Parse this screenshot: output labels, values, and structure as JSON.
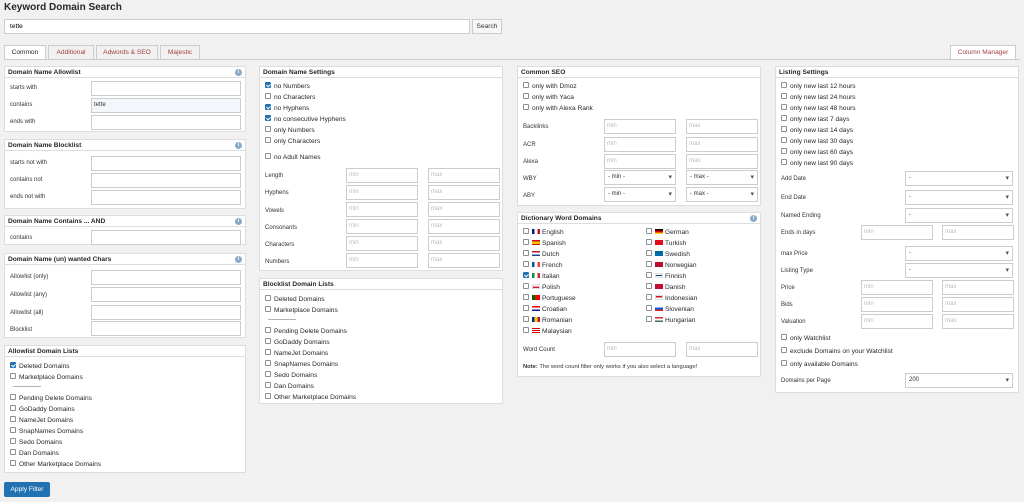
{
  "title": "Keyword Domain Search",
  "search": {
    "value": "tette",
    "button": "Search"
  },
  "tabs": [
    "Common",
    "Additional",
    "Adwords & SEO",
    "Majestic"
  ],
  "column_manager": "Column Manager",
  "apply_filter": "Apply Filter",
  "allowlist": {
    "title": "Domain Name Allowlist",
    "starts_with": "starts with",
    "contains": "contains",
    "contains_value": "tette",
    "ends_with": "ends with"
  },
  "blocklist": {
    "title": "Domain Name Blocklist",
    "starts_not_with": "starts not with",
    "contains_not": "contains not",
    "ends_not_with": "ends not with"
  },
  "contains_and": {
    "title": "Domain Name Contains ... AND",
    "contains": "contains"
  },
  "wanted_chars": {
    "title": "Domain Name (un) wanted Chars",
    "labels": [
      "Allowlist (only)",
      "Allowlist (any)",
      "Allowlist (all)",
      "Blocklist"
    ]
  },
  "allow_lists": {
    "title": "Allowlist Domain Lists",
    "items": [
      "Deleted Domains",
      "Marketplace Domains",
      "Pending Delete Domains",
      "GoDaddy Domains",
      "NameJet Domains",
      "SnapNames Domains",
      "Sedo Domains",
      "Dan Domains",
      "Other Marketplace Domains"
    ],
    "separator": "--------------"
  },
  "settings": {
    "title": "Domain Name Settings",
    "checks": [
      "no Numbers",
      "no Characters",
      "no Hyphens",
      "no consecutive Hyphens",
      "only Numbers",
      "only Characters",
      "no Adult Names"
    ],
    "rows": [
      "Length",
      "Hyphens",
      "Vowels",
      "Consonants",
      "Characters",
      "Numbers"
    ],
    "min": "min",
    "max": "max"
  },
  "block_lists": {
    "title": "Blocklist Domain Lists",
    "items": [
      "Deleted Domains",
      "Marketplace Domains",
      "Pending Delete Domains",
      "GoDaddy Domains",
      "NameJet Domains",
      "SnapNames Domains",
      "Sedo Domains",
      "Dan Domains",
      "Other Marketplace Domains"
    ],
    "separator": "--------------"
  },
  "seo": {
    "title": "Common SEO",
    "checks": [
      "only with Dmoz",
      "only with Yaca",
      "only with Alexa Rank"
    ],
    "rows": [
      "Backlinks",
      "ACR",
      "Alexa"
    ],
    "select_rows": [
      "WBY",
      "ABY"
    ],
    "min": "min",
    "max": "max",
    "sel_min": "- min -",
    "sel_max": "- max -"
  },
  "dict": {
    "title": "Dictionary Word Domains",
    "left": [
      "English",
      "Spanish",
      "Dutch",
      "French",
      "Italian",
      "Polish",
      "Portuguese",
      "Croatian",
      "Romanian",
      "Malaysian"
    ],
    "right": [
      "German",
      "Turkish",
      "Swedish",
      "Norwegian",
      "Finnish",
      "Danish",
      "Indonesian",
      "Slovenian",
      "Hungarian"
    ],
    "word_count": "Word Count",
    "min": "min",
    "max": "max",
    "note_bold": "Note:",
    "note": " The word count filter only works if you also select a language!"
  },
  "listing": {
    "title": "Listing Settings",
    "checks": [
      "only new last 12 hours",
      "only new last 24 hours",
      "only new last 48 hours",
      "only new last 7 days",
      "only new last 14 days",
      "only new last 30 days",
      "only new last 60 days",
      "only new last 90 days"
    ],
    "add_date": "Add Date",
    "end_date": "End Date",
    "named_ending": "Named Ending",
    "ends_in_days": "Ends in days",
    "max_price": "max Price",
    "listing_type": "Listing Type",
    "price": "Price",
    "bids": "Bids",
    "valuation": "Valuation",
    "dash": "-",
    "min": "min",
    "max": "max",
    "bottom_checks": [
      "only Watchlist",
      "exclude Domains on your Watchlist",
      "only available Domains"
    ],
    "per_page": "Domains per Page",
    "per_page_value": "200"
  },
  "colors": {
    "accent": "#2271b1",
    "tab_text": "#a04040"
  }
}
